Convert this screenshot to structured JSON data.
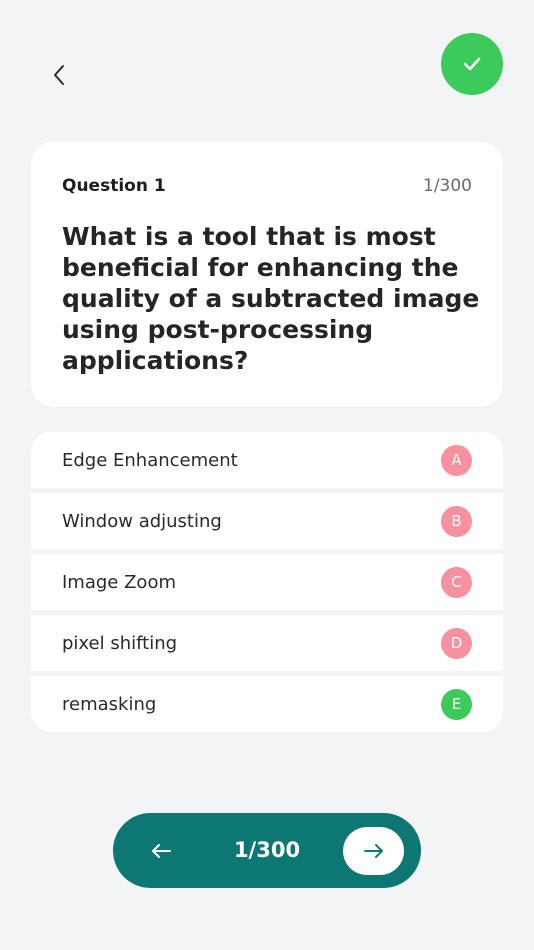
{
  "header": {
    "back_icon": "chevron-left-icon",
    "check_icon": "check-icon"
  },
  "question": {
    "label": "Question 1",
    "counter": "1/300",
    "text": "What is a tool that is most beneficial for enhancing the quality of a subtracted image using post-processing applications?"
  },
  "options": [
    {
      "label": "Edge Enhancement",
      "letter": "A",
      "correct": false
    },
    {
      "label": "Window adjusting",
      "letter": "B",
      "correct": false
    },
    {
      "label": "Image Zoom",
      "letter": "C",
      "correct": false
    },
    {
      "label": "pixel shifting",
      "letter": "D",
      "correct": false
    },
    {
      "label": "remasking",
      "letter": "E",
      "correct": true
    }
  ],
  "navigation": {
    "counter": "1/300",
    "prev_icon": "arrow-left-icon",
    "next_icon": "arrow-right-icon"
  },
  "colors": {
    "background": "#f3f4f6",
    "accent_green": "#3ccb5a",
    "option_badge": "#f7909f",
    "nav_teal": "#0d7873"
  }
}
